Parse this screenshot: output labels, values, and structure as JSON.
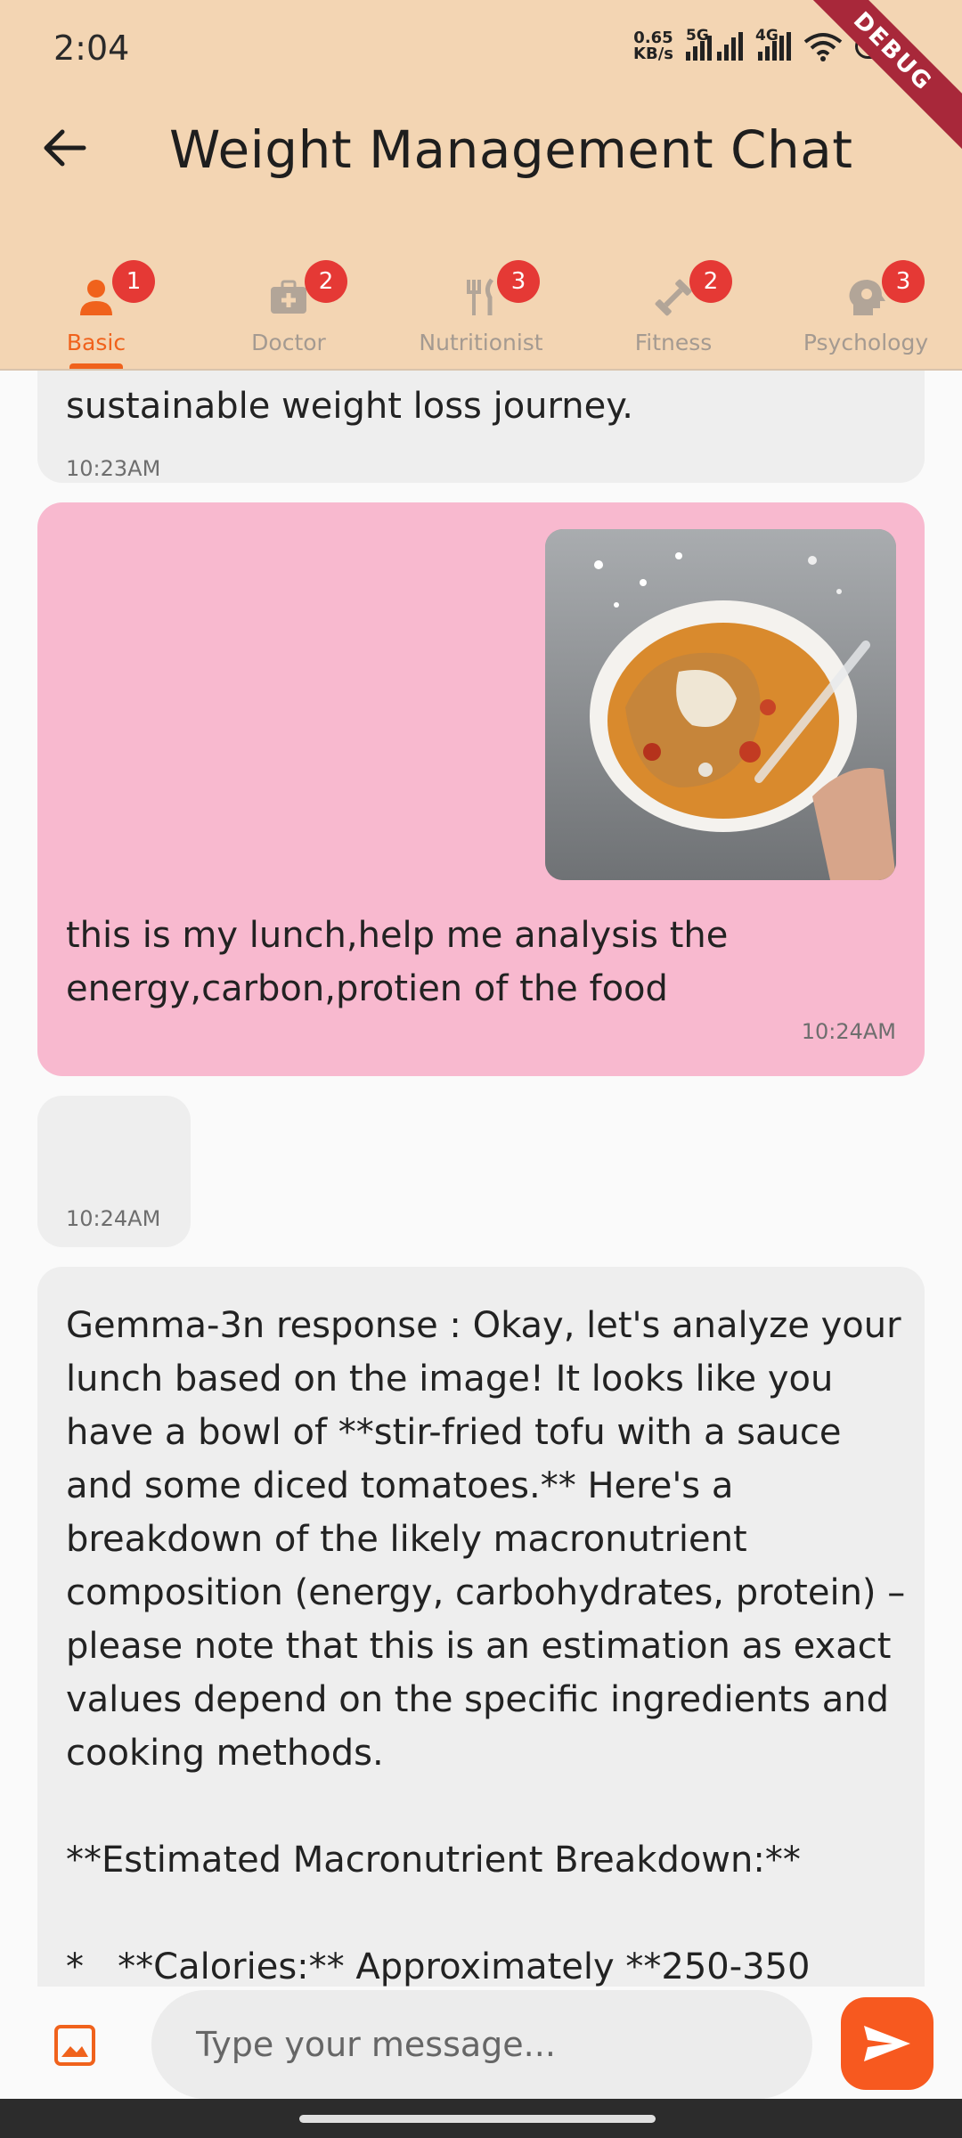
{
  "status_bar": {
    "time": "2:04",
    "net_speed_value": "0.65",
    "net_speed_unit": "KB/s",
    "signal1_tag": "5G",
    "signal2_tag": "4G",
    "battery": "81",
    "debug_label": "DEBUG"
  },
  "header": {
    "title": "Weight Management Chat",
    "back_icon": "arrow-left-icon"
  },
  "tabs": [
    {
      "label": "Basic",
      "badge": "1",
      "icon": "person-icon",
      "active": true
    },
    {
      "label": "Doctor",
      "badge": "2",
      "icon": "medical-bag-icon",
      "active": false
    },
    {
      "label": "Nutritionist",
      "badge": "3",
      "icon": "utensils-icon",
      "active": false
    },
    {
      "label": "Fitness",
      "badge": "2",
      "icon": "dumbbell-icon",
      "active": false
    },
    {
      "label": "Psychology",
      "badge": "3",
      "icon": "head-gear-icon",
      "active": false
    }
  ],
  "messages": [
    {
      "sender": "assistant",
      "text": "sustainable weight loss journey.",
      "time": "10:23AM"
    },
    {
      "sender": "user",
      "image": "lunch-photo",
      "text": "this is my lunch,help me analysis the energy,carbon,protien of the food",
      "time": "10:24AM"
    },
    {
      "sender": "assistant",
      "text": "",
      "time": "10:24AM"
    },
    {
      "sender": "assistant",
      "text": "Gemma-3n response : Okay, let's analyze your lunch based on the image! It looks like you have a bowl of **stir-fried tofu with a sauce and some diced tomatoes.** Here's a breakdown of the likely macronutrient composition (energy, carbohydrates, protein) – please note that this is an estimation as exact values depend on the specific ingredients and cooking methods.\n\n**Estimated Macronutrient Breakdown:**\n\n*   **Calories:** Approximately **250-350",
      "time": ""
    }
  ],
  "input": {
    "placeholder": "Type your message...",
    "value": "",
    "attach_icon": "image-icon",
    "send_icon": "send-icon"
  },
  "colors": {
    "header_bg": "#f3d5b3",
    "accent": "#f0621c",
    "user_bubble": "#f8b9cf",
    "assistant_bubble": "#eeeeee",
    "badge": "#e53935"
  }
}
